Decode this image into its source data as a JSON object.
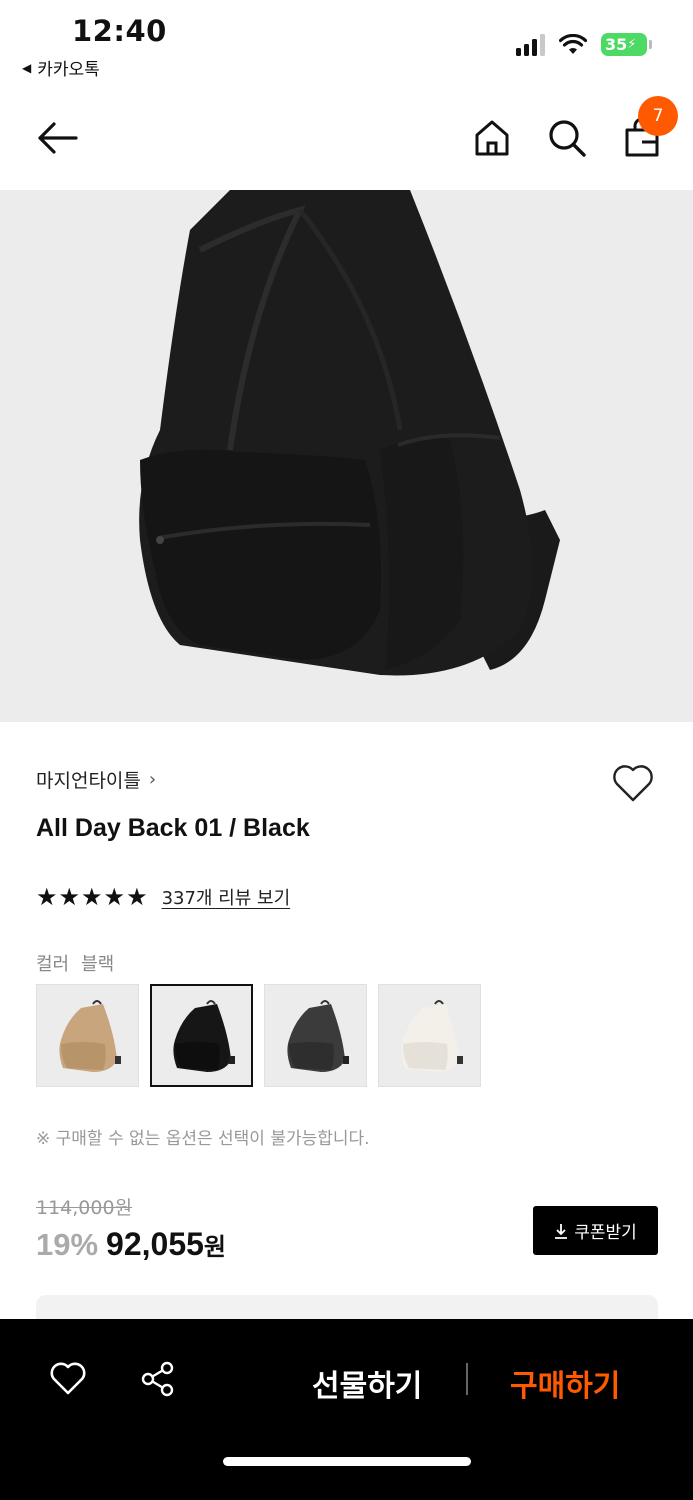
{
  "status": {
    "time": "12:40",
    "back_app": "카카오톡",
    "battery": "35"
  },
  "nav": {
    "cart_count": "7"
  },
  "product": {
    "brand": "마지언타이틀",
    "title": "All Day Back 01 / Black",
    "rating_stars": 5,
    "reviews_link": "337개 리뷰 보기",
    "color_label": "컬러",
    "color_value": "블랙",
    "swatches": [
      {
        "name": "beige",
        "color": "#c8a57c"
      },
      {
        "name": "black",
        "color": "#161616"
      },
      {
        "name": "charcoal",
        "color": "#3b3b3b"
      },
      {
        "name": "ivory",
        "color": "#efebe4"
      }
    ],
    "selected_swatch": 1,
    "notice": "※ 구매할 수 없는 옵션은 선택이 불가능합니다.",
    "original_price": "114,000원",
    "discount": "19%",
    "price": "92,055",
    "currency": "원",
    "coupon_button": "쿠폰받기"
  },
  "bottom_bar": {
    "gift_label": "선물하기",
    "buy_label": "구매하기"
  },
  "colors": {
    "accent": "#ff5a00",
    "hero_bg": "#ececec",
    "battery": "#4cd964"
  }
}
